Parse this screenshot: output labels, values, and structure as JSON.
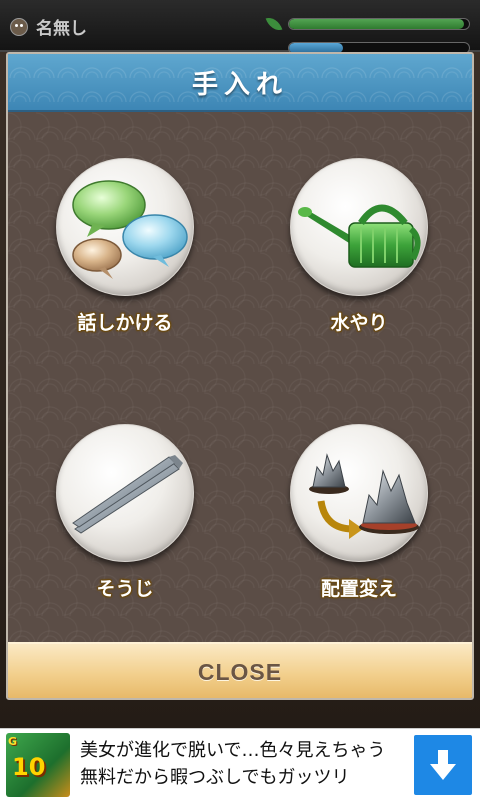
{
  "status_bar": {
    "player_name": "名無し",
    "gauges": [
      {
        "name": "growth",
        "fill_fraction": 0.97,
        "color": "#3f8f3f"
      },
      {
        "name": "water",
        "fill_fraction": 0.3,
        "color": "#3f8cc2"
      }
    ]
  },
  "modal": {
    "title": "手入れ",
    "actions": [
      {
        "id": "talk",
        "label": "話しかける",
        "icon": "speech-bubbles-icon"
      },
      {
        "id": "water",
        "label": "水やり",
        "icon": "watering-can-icon"
      },
      {
        "id": "clean",
        "label": "そうじ",
        "icon": "tweezers-icon"
      },
      {
        "id": "rearrange",
        "label": "配置変え",
        "icon": "rearrange-rocks-icon"
      }
    ],
    "close_label": "CLOSE"
  },
  "ad": {
    "thumb_badge": "G",
    "thumb_number": "10",
    "text": "美女が進化で脱いで…色々見えちゃう 無料だから暇つぶしでもガッツリ",
    "download_icon": "download-arrow-icon",
    "accent_color": "#1e88e5"
  },
  "colors": {
    "header_blue": "#4a95c4",
    "body_brown": "#5b4d46",
    "close_bar": "#f2cf8c",
    "label_outline": "#6b4a10"
  }
}
